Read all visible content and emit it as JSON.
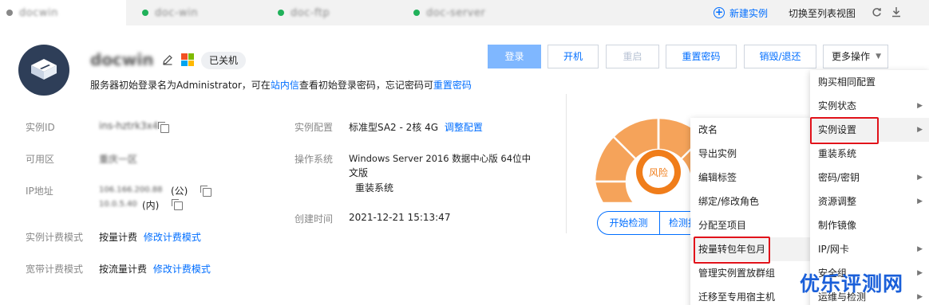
{
  "tabs": [
    {
      "name": "docwin",
      "dot_color": "#888888",
      "active": true
    },
    {
      "name": "doc-win",
      "dot_color": "#20b15a",
      "active": false
    },
    {
      "name": "doc-ftp",
      "dot_color": "#20b15a",
      "active": false
    },
    {
      "name": "doc-server",
      "dot_color": "#20b15a",
      "active": false
    }
  ],
  "tabbar_actions": {
    "new_instance": "新建实例",
    "switch_list": "切换至列表视图"
  },
  "instance": {
    "name": "docwin",
    "status": "已关机",
    "login_tip_prefix": "服务器初始登录名为Administrator，可在",
    "login_tip_link": "站内信",
    "login_tip_mid": "查看初始登录密码，忘记密码可",
    "login_tip_link2": "重置密码"
  },
  "actions": {
    "login": "登录",
    "start": "开机",
    "restart": "重启",
    "reset_pwd": "重置密码",
    "destroy": "销毁/退还",
    "more": "更多操作"
  },
  "details": {
    "instance_id_label": "实例ID",
    "instance_id": "ins-hztrk3x4",
    "zone_label": "可用区",
    "zone": "重庆一区",
    "ip_label": "IP地址",
    "ip_public": "106.166.200.88",
    "ip_public_tag": "(公)",
    "ip_private": "10.0.5.40",
    "ip_private_tag": "(内)",
    "billing_label": "实例计费模式",
    "billing": "按量计费",
    "billing_link": "修改计费模式",
    "bandwidth_label": "宽带计费模式",
    "bandwidth": "按流量计费",
    "bandwidth_link": "修改计费模式",
    "config_label": "实例配置",
    "config": "标准型SA2 - 2核 4G",
    "config_link": "调整配置",
    "os_label": "操作系统",
    "os_line1": "Windows Server 2016 数据中心版 64位中",
    "os_line2": "文版",
    "os_link": "重装系统",
    "created_label": "创建时间",
    "created": "2021-12-21 15:13:47"
  },
  "health": {
    "risk_label": "风险",
    "start_check": "开始检测",
    "check_report": "检测报告"
  },
  "more_menu": [
    {
      "label": "购买相同配置",
      "has_sub": false
    },
    {
      "label": "实例状态",
      "has_sub": true
    },
    {
      "label": "实例设置",
      "has_sub": true
    },
    {
      "label": "重装系统",
      "has_sub": false
    },
    {
      "label": "密码/密钥",
      "has_sub": true
    },
    {
      "label": "资源调整",
      "has_sub": true
    },
    {
      "label": "制作镜像",
      "has_sub": false
    },
    {
      "label": "IP/网卡",
      "has_sub": true
    },
    {
      "label": "安全组",
      "has_sub": true
    },
    {
      "label": "运维与检测",
      "has_sub": true
    }
  ],
  "settings_submenu": [
    {
      "label": "改名"
    },
    {
      "label": "导出实例"
    },
    {
      "label": "编辑标签"
    },
    {
      "label": "绑定/修改角色"
    },
    {
      "label": "分配至项目"
    },
    {
      "label": "按量转包年包月"
    },
    {
      "label": "管理实例置放群组"
    },
    {
      "label": "迁移至专用宿主机"
    }
  ],
  "watermark": "优乐评测网",
  "colors": {
    "accent": "#006eff",
    "risk": "#f07d1a",
    "highlight_box": "#e1121a"
  }
}
